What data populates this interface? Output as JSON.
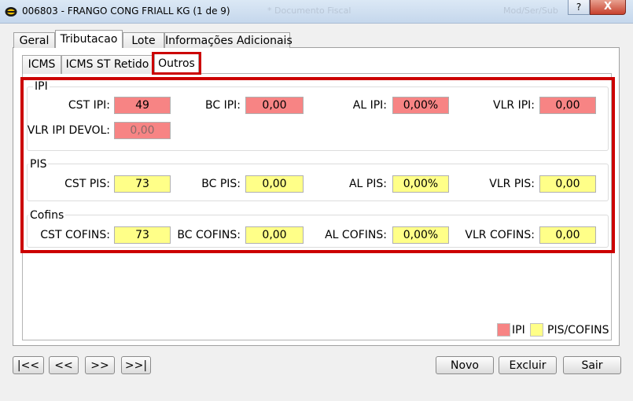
{
  "window": {
    "title": "006803 - FRANGO CONG FRIALL KG (1 de 9)",
    "ghost_text_1": "* Documento Fiscal",
    "ghost_text_2": "Mod/Ser/Sub",
    "help_label": "?",
    "close_label": "X"
  },
  "main_tabs": [
    "Geral",
    "Tributacao",
    "Lote",
    "Informações Adicionais"
  ],
  "active_main_tab": "Tributacao",
  "sub_tabs": [
    "ICMS",
    "ICMS ST Retido",
    "Outros"
  ],
  "active_sub_tab": "Outros",
  "groups": {
    "ipi": {
      "title": "IPI",
      "cst_label": "CST IPI:",
      "cst_value": "49",
      "bc_label": "BC IPI:",
      "bc_value": "0,00",
      "al_label": "AL IPI:",
      "al_value": "0,00%",
      "vlr_label": "VLR IPI:",
      "vlr_value": "0,00",
      "devol_label": "VLR IPI DEVOL:",
      "devol_value": "0,00"
    },
    "pis": {
      "title": "PIS",
      "cst_label": "CST PIS:",
      "cst_value": "73",
      "bc_label": "BC PIS:",
      "bc_value": "0,00",
      "al_label": "AL PIS:",
      "al_value": "0,00%",
      "vlr_label": "VLR PIS:",
      "vlr_value": "0,00"
    },
    "cofins": {
      "title": "Cofins",
      "cst_label": "CST COFINS:",
      "cst_value": "73",
      "bc_label": "BC COFINS:",
      "bc_value": "0,00",
      "al_label": "AL COFINS:",
      "al_value": "0,00%",
      "vlr_label": "VLR COFINS:",
      "vlr_value": "0,00"
    }
  },
  "legend": {
    "ipi": "IPI",
    "pis_cofins": "PIS/COFINS"
  },
  "colors": {
    "ipi": "#f78484",
    "pis_cofins": "#ffff88",
    "highlight": "#cc0000"
  },
  "nav_buttons": {
    "first": "|<<",
    "prev": "<<",
    "next": ">>",
    "last": ">>|"
  },
  "actions": {
    "new": "Novo",
    "delete": "Excluir",
    "exit": "Sair"
  }
}
